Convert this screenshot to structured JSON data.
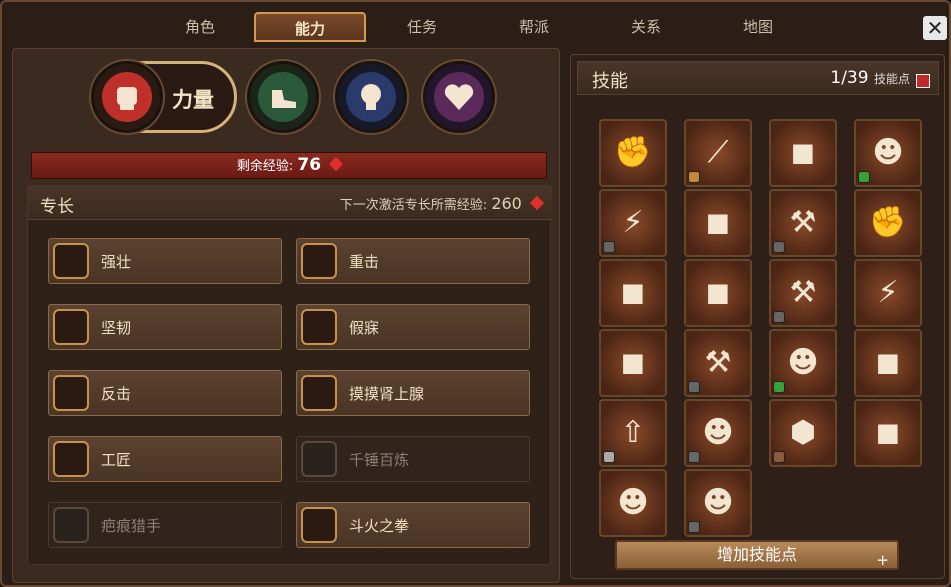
{
  "tabs": [
    {
      "label": "角色"
    },
    {
      "label": "能力"
    },
    {
      "label": "任务"
    },
    {
      "label": "帮派"
    },
    {
      "label": "关系"
    },
    {
      "label": "地图"
    }
  ],
  "active_tab": "能力",
  "close_label": "✕",
  "attributes": {
    "strength_label": "力量",
    "items": [
      {
        "name": "strength",
        "icon": "fist-icon",
        "color": "#c0302a"
      },
      {
        "name": "agility",
        "icon": "shoe-icon",
        "color": "#2a5a3a"
      },
      {
        "name": "intellect",
        "icon": "lightbulb-icon",
        "color": "#2a3a6a"
      },
      {
        "name": "charisma",
        "icon": "heart-icon",
        "color": "#5a2a5a"
      }
    ]
  },
  "xp": {
    "label": "剩余经验:",
    "value": "76"
  },
  "specialty": {
    "title": "专长",
    "next_label": "下一次激活专长所需经验:",
    "next_value": "260",
    "perks": [
      {
        "label": "强壮",
        "icon": "chevrons-up-icon",
        "locked": false
      },
      {
        "label": "重击",
        "icon": "slash-marks-icon",
        "locked": false
      },
      {
        "label": "坚韧",
        "icon": "sparkle-icon",
        "locked": false
      },
      {
        "label": "假寐",
        "icon": "sparkle-icon",
        "locked": false
      },
      {
        "label": "反击",
        "icon": "slash-marks-icon",
        "locked": false
      },
      {
        "label": "摸摸肾上腺",
        "icon": "slash-marks-icon",
        "locked": false
      },
      {
        "label": "工匠",
        "icon": "gear-icon",
        "locked": false
      },
      {
        "label": "千锤百炼",
        "icon": "dice-icon",
        "locked": true
      },
      {
        "label": "疤痕猎手",
        "icon": "sparkle-icon",
        "locked": true
      },
      {
        "label": "斗火之拳",
        "icon": "slash-marks-icon",
        "locked": false
      }
    ]
  },
  "skills": {
    "title": "技能",
    "count": "1/39",
    "points_label": "技能点",
    "add_button": "增加技能点",
    "add_plus": "+",
    "items": [
      {
        "icon": "flex-arm-icon",
        "glyph": "✊",
        "badge": ""
      },
      {
        "icon": "claw-marks-icon",
        "glyph": "⟋",
        "badge": "#c08a3a"
      },
      {
        "icon": "portrait-icon",
        "glyph": "◼",
        "badge": ""
      },
      {
        "icon": "drinking-figure-icon",
        "glyph": "☻",
        "badge": "#3aa03a"
      },
      {
        "icon": "lightning-icon",
        "glyph": "⚡",
        "badge": "#666"
      },
      {
        "icon": "portrait-icon",
        "glyph": "◼",
        "badge": ""
      },
      {
        "icon": "hammer-pile-icon",
        "glyph": "⚒",
        "badge": "#666"
      },
      {
        "icon": "punch-icon",
        "glyph": "✊",
        "badge": ""
      },
      {
        "icon": "portrait-icon",
        "glyph": "◼",
        "badge": ""
      },
      {
        "icon": "portrait-icon",
        "glyph": "◼",
        "badge": ""
      },
      {
        "icon": "hammer-icon",
        "glyph": "⚒",
        "badge": "#666"
      },
      {
        "icon": "lightning-ring-icon",
        "glyph": "⚡",
        "badge": ""
      },
      {
        "icon": "portrait-icon",
        "glyph": "◼",
        "badge": ""
      },
      {
        "icon": "hammer-icon",
        "glyph": "⚒",
        "badge": "#666"
      },
      {
        "icon": "figure-icon",
        "glyph": "☻",
        "badge": "#3aa03a"
      },
      {
        "icon": "portrait-icon",
        "glyph": "◼",
        "badge": ""
      },
      {
        "icon": "arrow-up-icon",
        "glyph": "⇧",
        "badge": "#aaa"
      },
      {
        "icon": "figure-up-icon",
        "glyph": "☻",
        "badge": "#666"
      },
      {
        "icon": "turtle-shell-icon",
        "glyph": "⬢",
        "badge": "#8a5a3a"
      },
      {
        "icon": "portrait-icon",
        "glyph": "◼",
        "badge": ""
      },
      {
        "icon": "sitting-figure-icon",
        "glyph": "☻",
        "badge": ""
      },
      {
        "icon": "armored-figure-icon",
        "glyph": "☻",
        "badge": "#666"
      }
    ]
  }
}
